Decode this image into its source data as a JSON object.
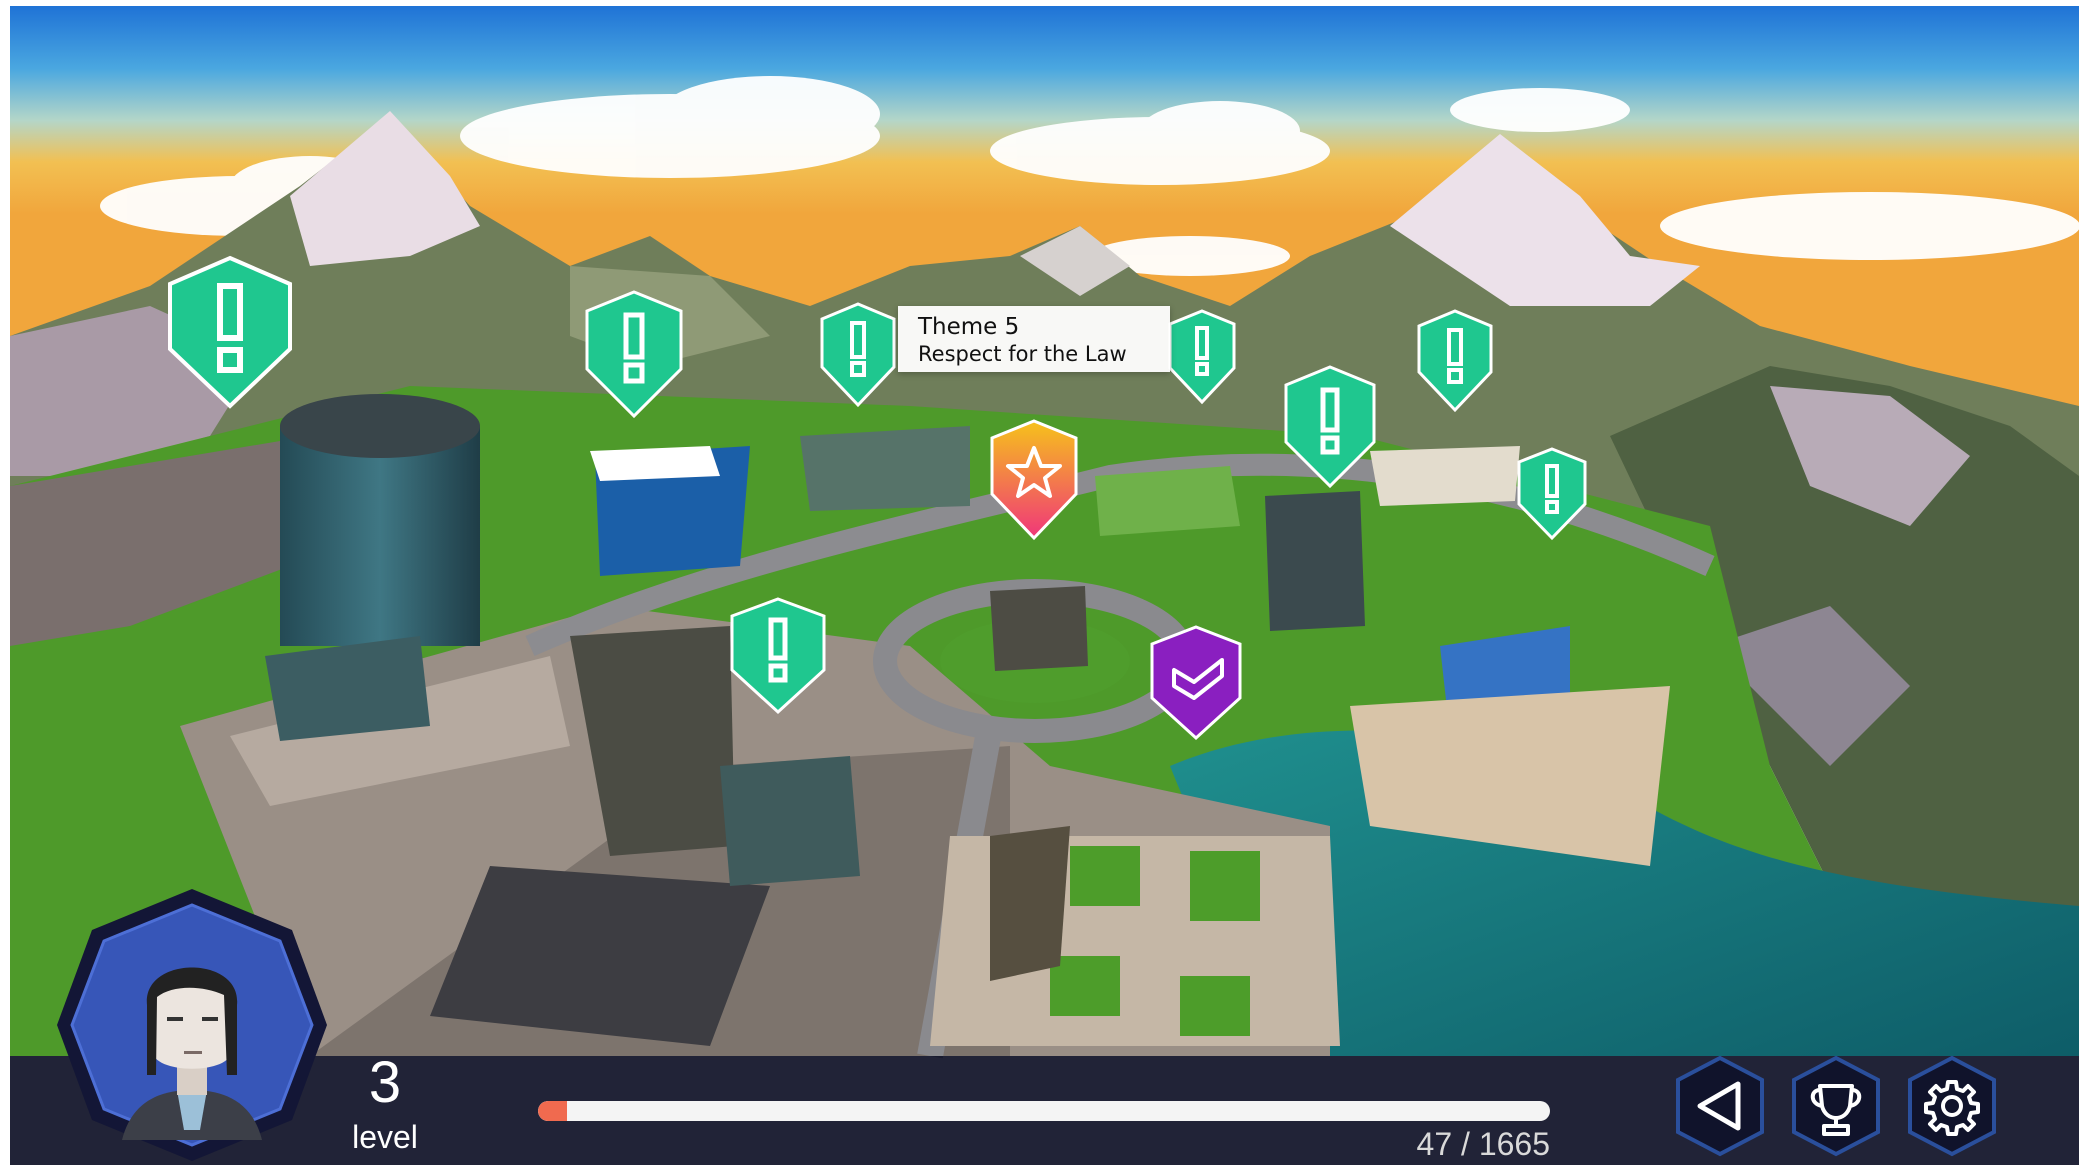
{
  "tooltip": {
    "theme": "Theme 5",
    "subtitle": "Respect for the Law"
  },
  "map_markers": [
    {
      "type": "alert",
      "icon": "exclamation-icon",
      "state": "available"
    },
    {
      "type": "alert",
      "icon": "exclamation-icon",
      "state": "available"
    },
    {
      "type": "alert",
      "icon": "exclamation-icon",
      "state": "available"
    },
    {
      "type": "alert",
      "icon": "exclamation-icon",
      "state": "available"
    },
    {
      "type": "alert",
      "icon": "exclamation-icon",
      "state": "available"
    },
    {
      "type": "alert",
      "icon": "exclamation-icon",
      "state": "available"
    },
    {
      "type": "alert",
      "icon": "exclamation-icon",
      "state": "available"
    },
    {
      "type": "alert",
      "icon": "exclamation-icon",
      "state": "available"
    },
    {
      "type": "star",
      "icon": "star-icon",
      "state": "featured"
    },
    {
      "type": "done",
      "icon": "checkmark-icon",
      "state": "completed"
    }
  ],
  "player": {
    "level": "3",
    "level_label": "level",
    "avatar": "player-avatar"
  },
  "progress": {
    "current": 47,
    "max": 1665,
    "text": "47 / 1665",
    "fill_color": "#f06a4f"
  },
  "hud_buttons": [
    {
      "name": "back-button",
      "icon": "back-arrow-icon"
    },
    {
      "name": "achievements-button",
      "icon": "trophy-icon"
    },
    {
      "name": "settings-button",
      "icon": "gear-icon"
    }
  ],
  "colors": {
    "alert_marker": "#1fc78f",
    "star_marker_top": "#f6c21b",
    "star_marker_bottom": "#f0367a",
    "done_marker": "#8a1fc0",
    "hud_background": "#0e1026",
    "hud_icon_border": "#2a4f9c"
  }
}
